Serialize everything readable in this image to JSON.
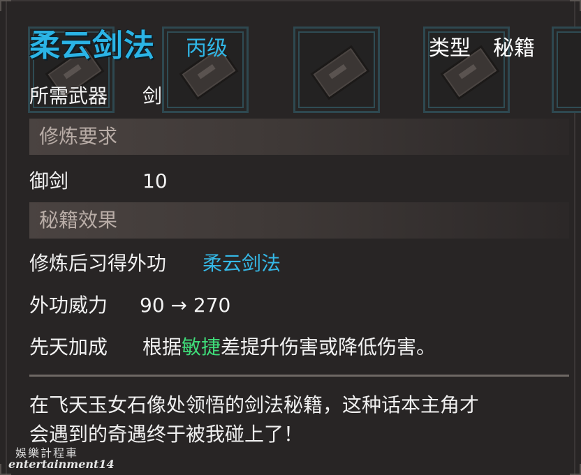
{
  "header": {
    "title": "柔云剑法",
    "grade": "丙级",
    "type_label": "类型",
    "type_value": "秘籍"
  },
  "weapon": {
    "label": "所需武器",
    "value": "剑"
  },
  "requirements": {
    "section_title": "修炼要求",
    "skill_name": "御剑",
    "skill_value": "10"
  },
  "effects": {
    "section_title": "秘籍效果",
    "learn_label": "修炼后习得外功",
    "learn_value": "柔云剑法",
    "power_label": "外功威力",
    "power_value": "90 → 270",
    "bonus_label": "先天加成",
    "bonus_prefix": "根据",
    "bonus_highlight": "敏捷",
    "bonus_suffix": "差提升伤害或降低伤害。"
  },
  "description": {
    "line1": "在飞天玉女石像处领悟的剑法秘籍，这种话本主角才",
    "line2": "会遇到的奇遇终于被我碰上了！"
  },
  "watermark": {
    "line1": "娛樂計程車",
    "line2": "entertainment14"
  },
  "colors": {
    "title": "#2bb4e6",
    "highlight_green": "#3fdc79",
    "panel_bg": "#282525"
  }
}
